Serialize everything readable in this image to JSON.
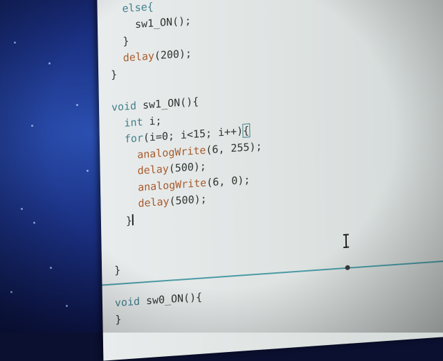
{
  "code_lines": [
    {
      "indent": "  ",
      "parts": [
        {
          "t": "else{",
          "c": "kw"
        }
      ]
    },
    {
      "indent": "    ",
      "parts": [
        {
          "t": "sw1_ON();",
          "c": "plain"
        }
      ]
    },
    {
      "indent": "  ",
      "parts": [
        {
          "t": "}",
          "c": "plain"
        }
      ]
    },
    {
      "indent": "  ",
      "parts": [
        {
          "t": "delay",
          "c": "fn"
        },
        {
          "t": "(200);",
          "c": "plain"
        }
      ]
    },
    {
      "indent": "",
      "parts": [
        {
          "t": "}",
          "c": "plain"
        }
      ]
    },
    {
      "indent": "",
      "parts": []
    },
    {
      "indent": "",
      "parts": [
        {
          "t": "void",
          "c": "kw"
        },
        {
          "t": " sw1_ON(){",
          "c": "plain"
        }
      ]
    },
    {
      "indent": "  ",
      "parts": [
        {
          "t": "int",
          "c": "kw"
        },
        {
          "t": " i;",
          "c": "plain"
        }
      ]
    },
    {
      "indent": "  ",
      "parts": [
        {
          "t": "for",
          "c": "kw"
        },
        {
          "t": "(i=0; i<15; i++)",
          "c": "plain"
        },
        {
          "t": "{",
          "c": "plain",
          "hl": true
        }
      ]
    },
    {
      "indent": "    ",
      "parts": [
        {
          "t": "analogWrite",
          "c": "fn"
        },
        {
          "t": "(6, 255);",
          "c": "plain"
        }
      ]
    },
    {
      "indent": "    ",
      "parts": [
        {
          "t": "delay",
          "c": "fn"
        },
        {
          "t": "(500);",
          "c": "plain"
        }
      ]
    },
    {
      "indent": "    ",
      "parts": [
        {
          "t": "analogWrite",
          "c": "fn"
        },
        {
          "t": "(6, 0);",
          "c": "plain"
        }
      ]
    },
    {
      "indent": "    ",
      "parts": [
        {
          "t": "delay",
          "c": "fn"
        },
        {
          "t": "(500);",
          "c": "plain"
        }
      ]
    },
    {
      "indent": "  ",
      "parts": [
        {
          "t": "}",
          "c": "plain",
          "caret": true
        }
      ]
    },
    {
      "indent": "",
      "parts": []
    },
    {
      "indent": "",
      "parts": []
    },
    {
      "indent": "",
      "parts": [
        {
          "t": "}",
          "c": "plain"
        }
      ]
    },
    {
      "indent": "",
      "parts": []
    },
    {
      "indent": "",
      "parts": [
        {
          "t": "void",
          "c": "kw"
        },
        {
          "t": " sw0_ON(){",
          "c": "plain"
        }
      ]
    },
    {
      "indent": "",
      "parts": [
        {
          "t": "}",
          "c": "plain"
        }
      ]
    }
  ],
  "colors": {
    "keyword": "#3e7f8c",
    "function": "#a85a2a",
    "text": "#2c3530",
    "editor_bg": "#e3e7e6",
    "desktop": "#1a2f80"
  }
}
